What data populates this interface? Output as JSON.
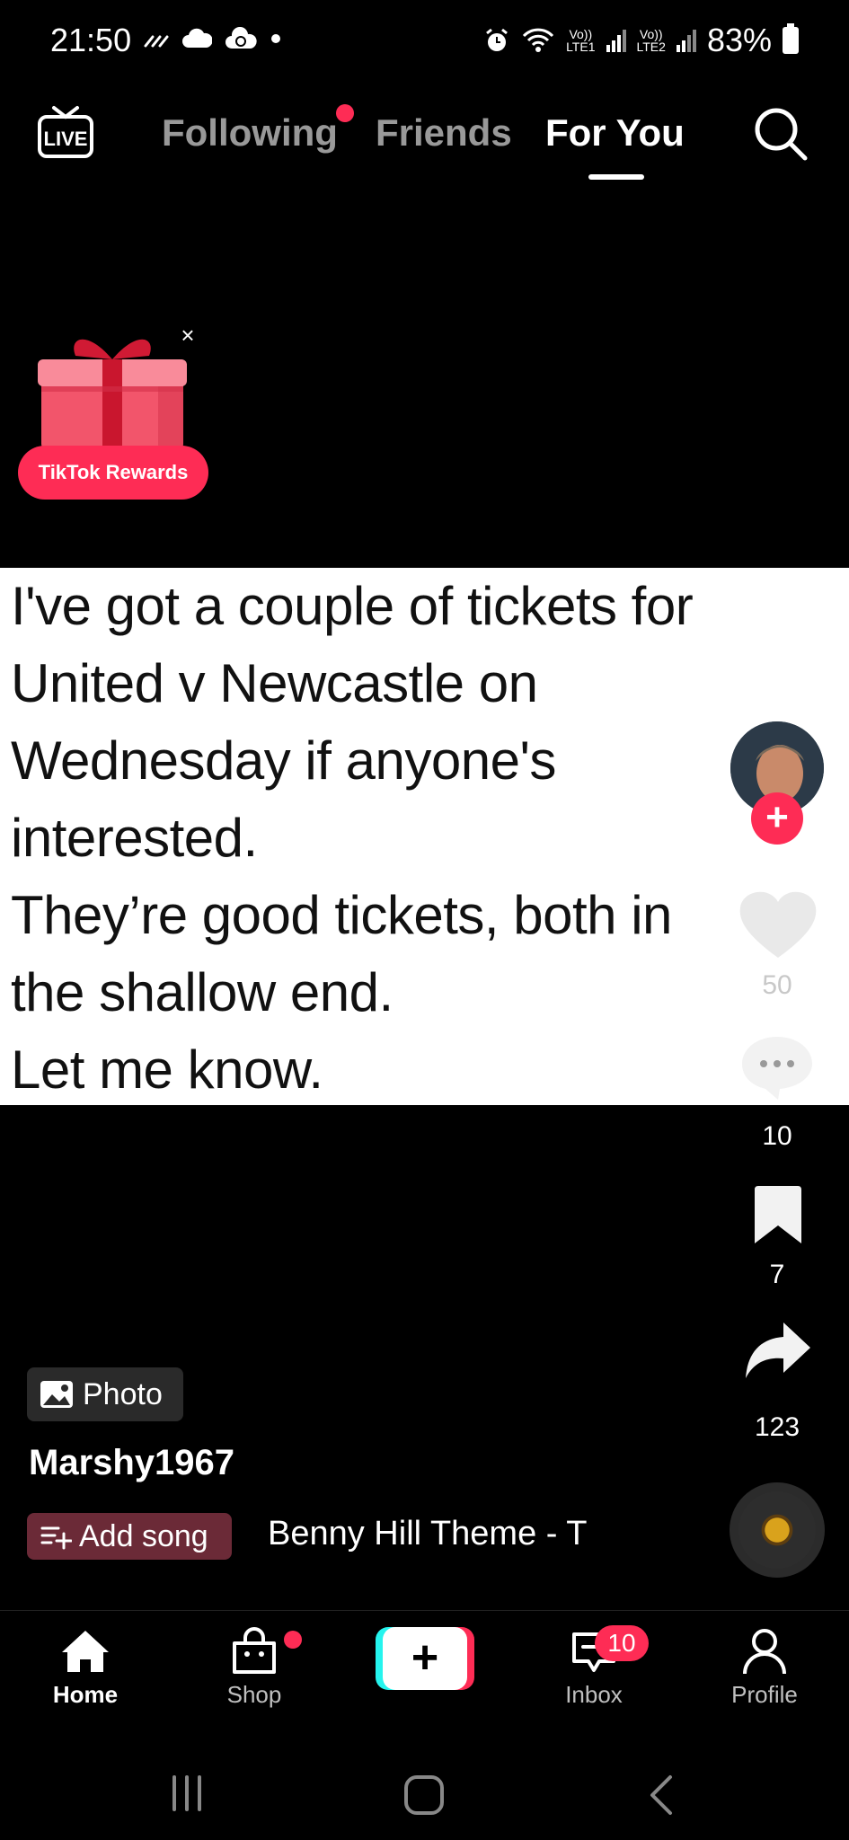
{
  "status_bar": {
    "time": "21:50",
    "net1_top": "Vo))",
    "net1_bottom": "LTE1",
    "net2_top": "Vo))",
    "net2_bottom": "LTE2",
    "battery": "83%"
  },
  "top_nav": {
    "live_label": "LIVE",
    "tabs": [
      {
        "label": "Following"
      },
      {
        "label": "Friends"
      },
      {
        "label": "For You"
      }
    ]
  },
  "rewards": {
    "label": "TikTok Rewards",
    "close": "×"
  },
  "post": {
    "lines": [
      "I've got a couple of tickets for",
      "United v Newcastle on",
      "Wednesday if anyone's",
      "interested.",
      "They’re good tickets, both in",
      "the shallow end.",
      "Let me know."
    ]
  },
  "actions": {
    "likes": "50",
    "comments": "10",
    "saves": "7",
    "shares": "123"
  },
  "info": {
    "badge": "Photo",
    "username": "Marshy1967",
    "add_song": "Add song",
    "music": "Benny Hill Theme - T"
  },
  "bottom_nav": {
    "home": "Home",
    "shop": "Shop",
    "inbox": "Inbox",
    "inbox_badge": "10",
    "profile": "Profile",
    "create": "+"
  },
  "colors": {
    "accent": "#fe2c55",
    "cyan": "#25f4ee",
    "background": "#000000",
    "post_background": "#ffffff"
  }
}
